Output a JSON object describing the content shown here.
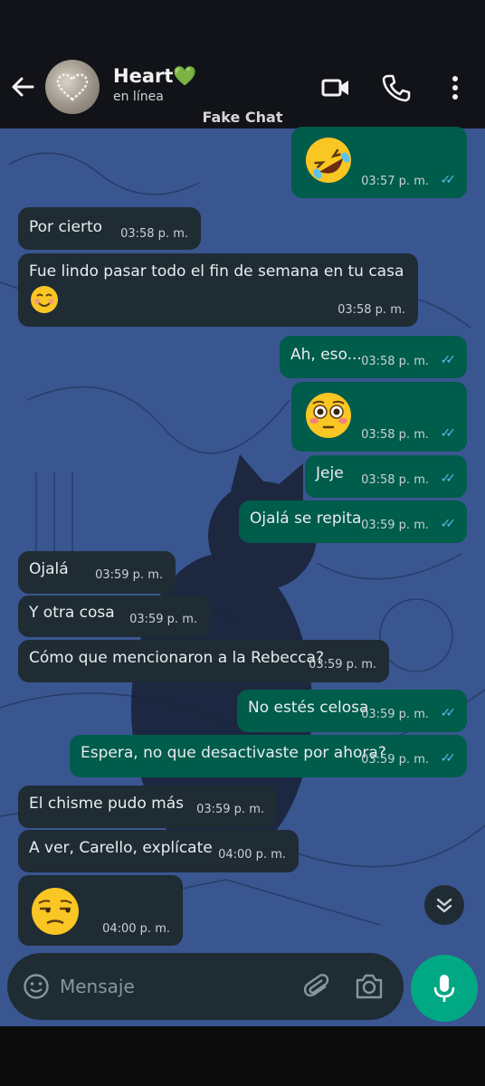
{
  "header": {
    "contact_name": "Heart💚",
    "status": "en línea",
    "label": "Fake Chat"
  },
  "messages": [
    {
      "dir": "out",
      "text": "",
      "emoji": "rolling-on-floor-laughing",
      "time": "03:57 p. m."
    },
    {
      "dir": "in",
      "text": "Por cierto",
      "time": "03:58 p. m."
    },
    {
      "dir": "in",
      "text": "Fue lindo pasar todo el fin de semana en tu casa",
      "emoji": "smiling-face",
      "time": "03:58 p. m."
    },
    {
      "dir": "out",
      "text": "Ah, eso...",
      "time": "03:58 p. m."
    },
    {
      "dir": "out",
      "text": "",
      "emoji": "flushed-face",
      "time": "03:58 p. m."
    },
    {
      "dir": "out",
      "text": "Jeje",
      "time": "03:58 p. m."
    },
    {
      "dir": "out",
      "text": "Ojalá se repita",
      "time": "03:59 p. m."
    },
    {
      "dir": "in",
      "text": "Ojalá",
      "time": "03:59 p. m."
    },
    {
      "dir": "in",
      "text": "Y otra cosa",
      "time": "03:59 p. m."
    },
    {
      "dir": "in",
      "text": "Cómo que mencionaron a la Rebecca?",
      "time": "03:59 p. m."
    },
    {
      "dir": "out",
      "text": "No estés celosa",
      "time": "03:59 p. m."
    },
    {
      "dir": "out",
      "text": "Espera, no que desactivaste por ahora?",
      "time": "03:59 p. m."
    },
    {
      "dir": "in",
      "text": "El chisme pudo más",
      "time": "03:59 p. m."
    },
    {
      "dir": "in",
      "text": "A ver, Carello, explícate",
      "time": "04:00 p. m."
    },
    {
      "dir": "in",
      "text": "",
      "emoji": "unamused-face",
      "time": "04:00 p. m."
    }
  ],
  "input": {
    "placeholder": "Mensaje"
  },
  "colors": {
    "header_bg": "#111318",
    "chat_bg": "#3a5691",
    "bubble_in": "#1f2c34",
    "bubble_out": "#005c4b",
    "read_ticks": "#53bdeb",
    "accent": "#00a884"
  },
  "icons": [
    "back-arrow-icon",
    "video-call-icon",
    "phone-icon",
    "more-options-icon",
    "emoji-icon",
    "attach-icon",
    "camera-icon",
    "mic-icon",
    "scroll-down-icon"
  ]
}
